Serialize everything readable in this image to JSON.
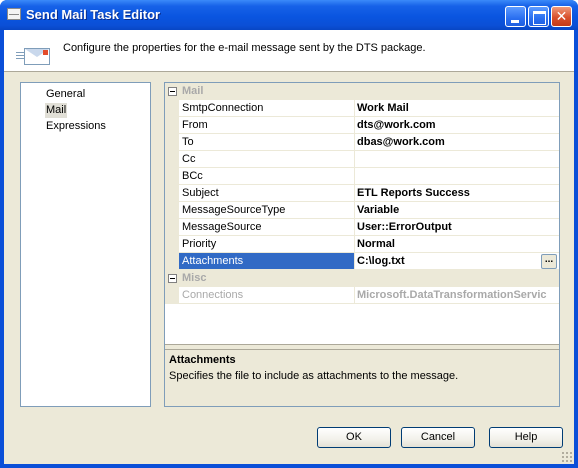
{
  "window": {
    "title": "Send Mail Task Editor",
    "accent_color": "#0a4fd8",
    "close_label": "✕"
  },
  "header": {
    "icon": "mail-icon",
    "description": "Configure the properties for the e-mail message sent by the DTS package."
  },
  "nav": {
    "items": [
      {
        "label": "General",
        "selected": false
      },
      {
        "label": "Mail",
        "selected": true
      },
      {
        "label": "Expressions",
        "selected": false
      }
    ]
  },
  "properties": {
    "categories": [
      {
        "label": "Mail",
        "rows": [
          {
            "name": "SmtpConnection",
            "value": "Work Mail"
          },
          {
            "name": "From",
            "value": "dts@work.com"
          },
          {
            "name": "To",
            "value": "dbas@work.com"
          },
          {
            "name": "Cc",
            "value": ""
          },
          {
            "name": "BCc",
            "value": ""
          },
          {
            "name": "Subject",
            "value": "ETL Reports Success"
          },
          {
            "name": "MessageSourceType",
            "value": "Variable"
          },
          {
            "name": "MessageSource",
            "value": "User::ErrorOutput"
          },
          {
            "name": "Priority",
            "value": "Normal"
          },
          {
            "name": "Attachments",
            "value": "C:\\log.txt",
            "selected": true
          }
        ]
      },
      {
        "label": "Misc",
        "rows": [
          {
            "name": "Connections",
            "value": "Microsoft.DataTransformationServic"
          }
        ]
      }
    ],
    "ellipsis_label": "..."
  },
  "help": {
    "title": "Attachments",
    "description": "Specifies the file to include as attachments to the message."
  },
  "buttons": {
    "ok": "OK",
    "cancel": "Cancel",
    "help": "Help"
  }
}
